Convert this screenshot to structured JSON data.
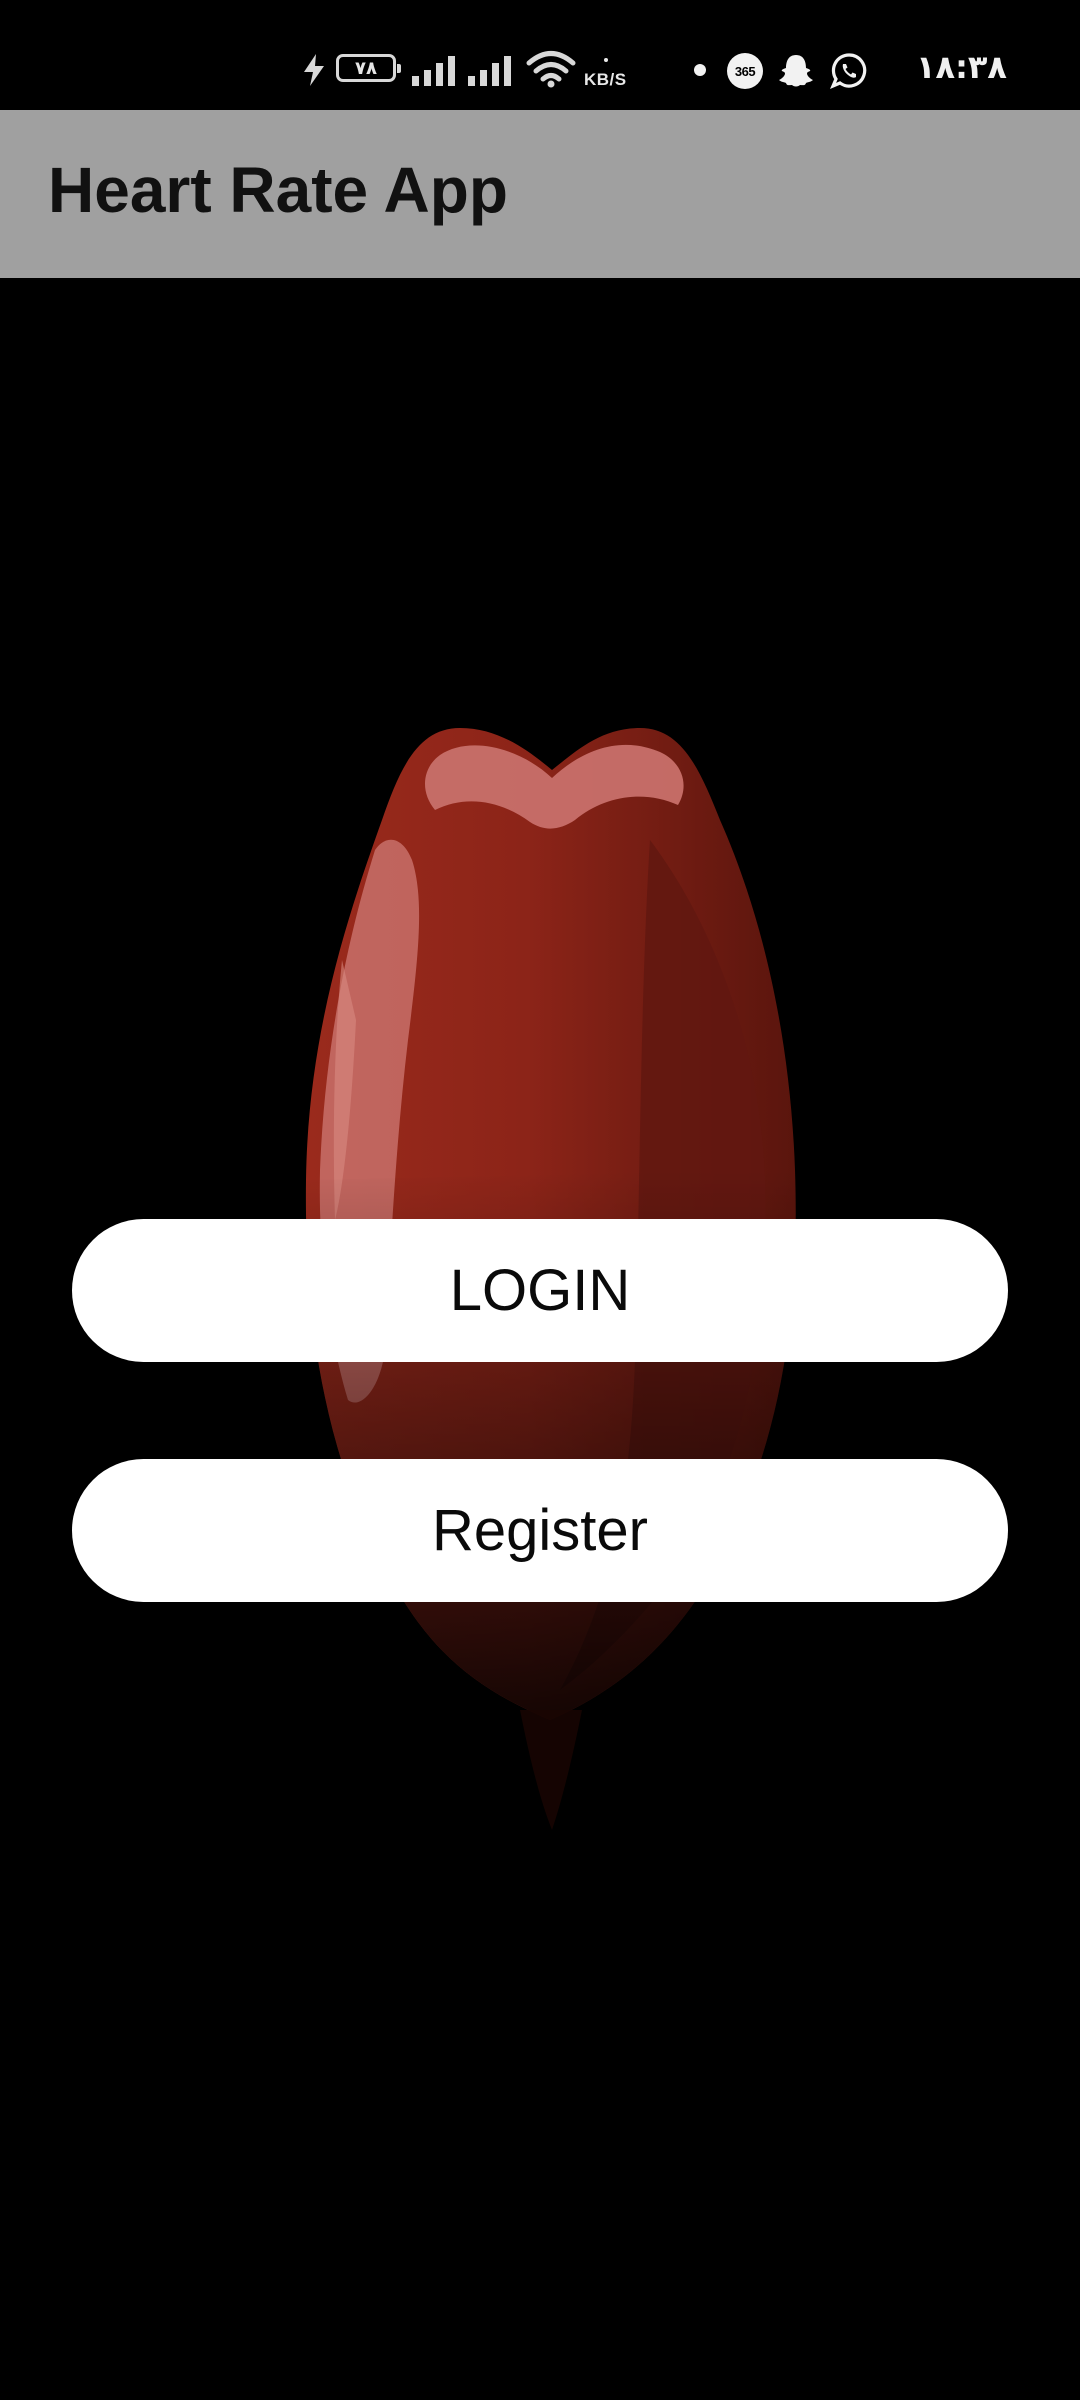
{
  "status_bar": {
    "battery_level": "۷۸",
    "network_speed_unit": "KB/S",
    "app_badge": "365",
    "time": "۱۸:۳۸",
    "icons": [
      "charging-bolt-icon",
      "battery-icon",
      "cell-signal-icon",
      "cell-signal-icon",
      "wifi-icon",
      "notification-dot-icon",
      "app-365-icon",
      "ghost-icon",
      "whatsapp-icon"
    ]
  },
  "app_bar": {
    "title": "Heart Rate App"
  },
  "hero": {
    "image": "red-heart-illustration"
  },
  "actions": {
    "login_label": "LOGIN",
    "register_label": "Register"
  },
  "colors": {
    "background": "#000000",
    "app_bar": "#a0a0a0",
    "button_bg": "#ffffff",
    "button_text": "#0a0a0a",
    "heart_main": "#8c2418",
    "heart_highlight": "#c8706a",
    "heart_shadow": "#5a150d"
  }
}
